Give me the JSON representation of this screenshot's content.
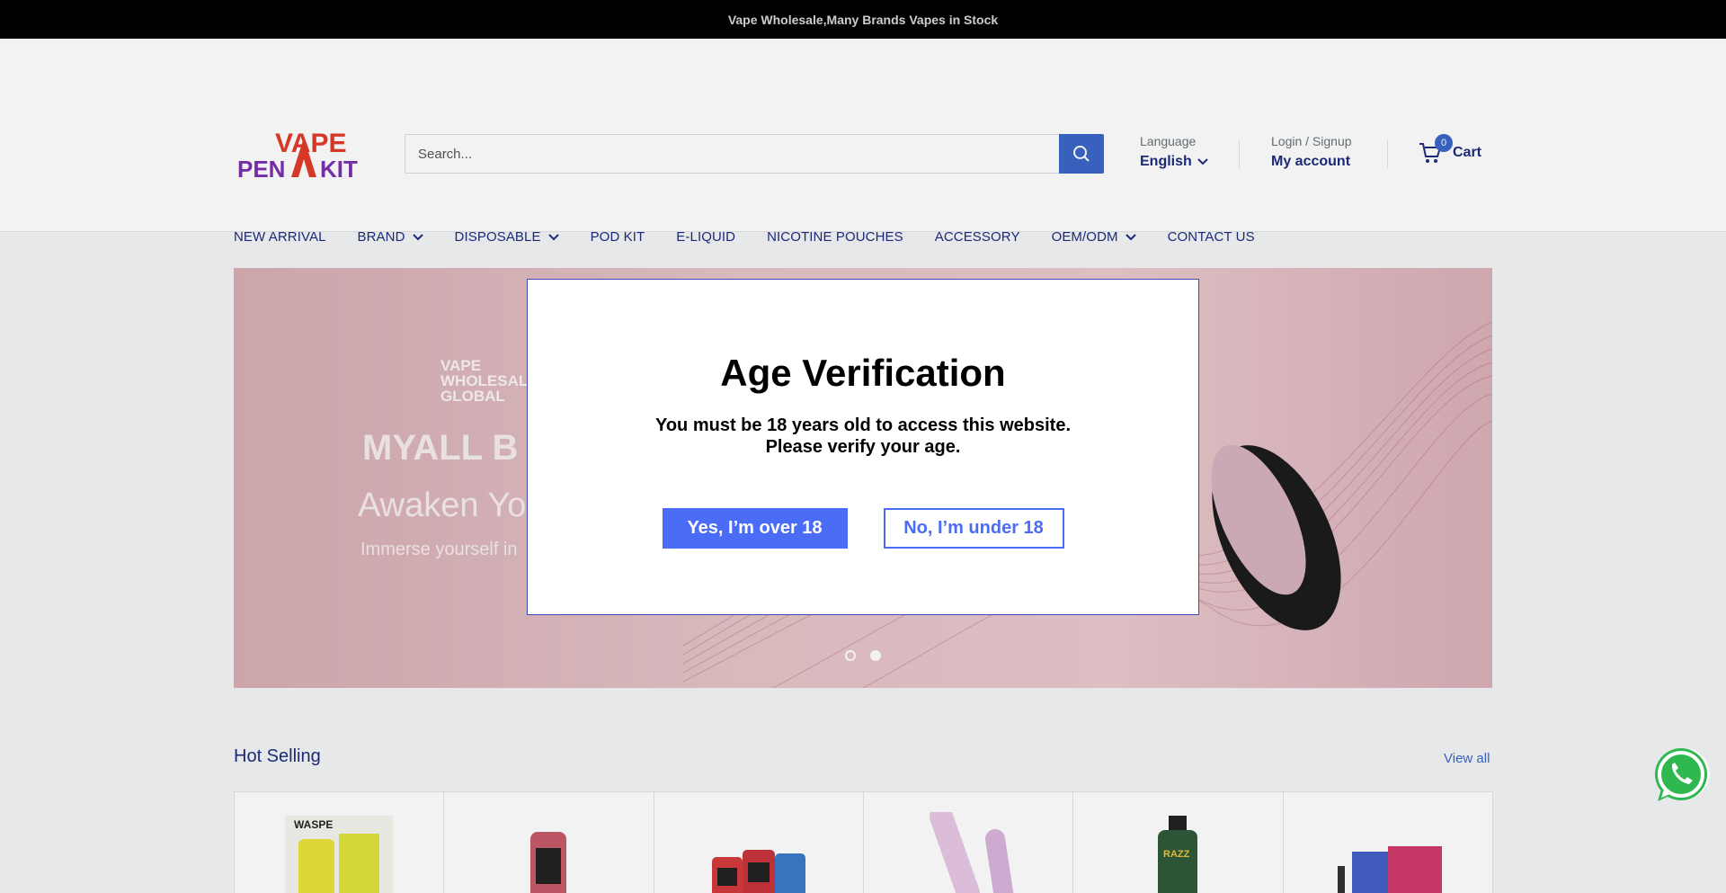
{
  "announcement": {
    "text": "Vape Wholesale,Many Brands Vapes in Stock"
  },
  "logo": {
    "alt_text": "VAPE PEN KIT"
  },
  "search": {
    "placeholder": "Search..."
  },
  "language": {
    "label": "Language",
    "value": "English"
  },
  "account": {
    "label": "Login / Signup",
    "link": "My account"
  },
  "cart": {
    "count": "0",
    "label": "Cart"
  },
  "nav": {
    "items": [
      {
        "label": "NEW ARRIVAL",
        "dropdown": false
      },
      {
        "label": "BRAND",
        "dropdown": true
      },
      {
        "label": "DISPOSABLE",
        "dropdown": true
      },
      {
        "label": "POD KIT",
        "dropdown": false
      },
      {
        "label": "E-LIQUID",
        "dropdown": false
      },
      {
        "label": "NICOTINE POUCHES",
        "dropdown": false
      },
      {
        "label": "ACCESSORY",
        "dropdown": false
      },
      {
        "label": "OEM/ODM",
        "dropdown": true
      },
      {
        "label": "CONTACT US",
        "dropdown": false
      }
    ]
  },
  "hero": {
    "brand_line1": "VAPE",
    "brand_line2": "WHOLESALE",
    "brand_line3": "GLOBAL",
    "title": "MYALL B",
    "subtitle": "Awaken Yo",
    "text": "Immerse yourself in"
  },
  "hot_selling": {
    "title": "Hot Selling",
    "view_all": "View all"
  },
  "modal": {
    "title": "Age Verification",
    "message": "You must be 18 years old to access this website.\nPlease verify your age.",
    "yes_label": "Yes, I’m over 18",
    "no_label": "No, I’m under 18"
  },
  "colors": {
    "accent": "#3b67c8",
    "modal_button": "#4a6cf7",
    "nav_text": "#1e2d7d"
  }
}
